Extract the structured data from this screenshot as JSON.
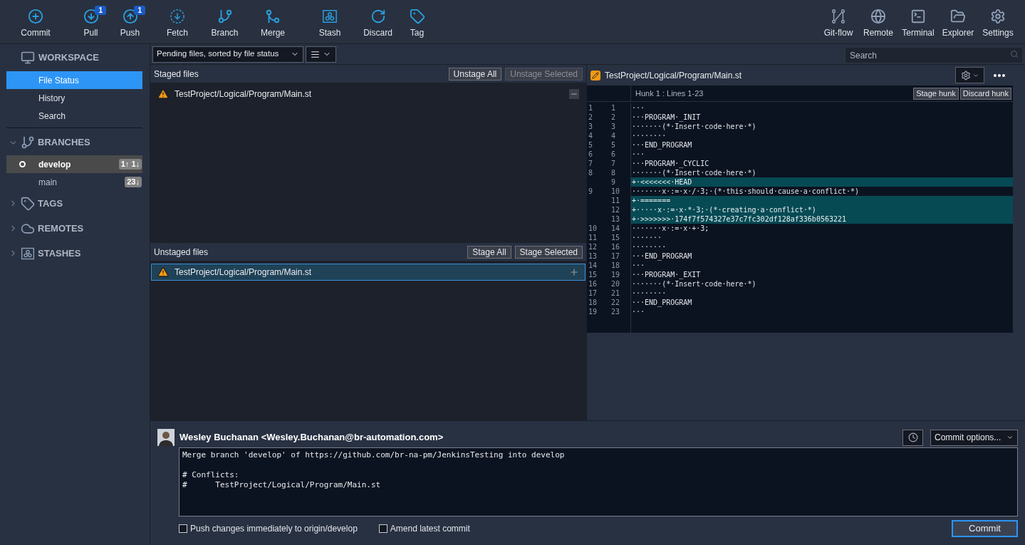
{
  "toolbar": {
    "left": [
      {
        "label": "Commit"
      },
      {
        "label": "Pull",
        "badge": "1"
      },
      {
        "label": "Push",
        "badge": "1"
      },
      {
        "label": "Fetch"
      },
      {
        "label": "Branch"
      },
      {
        "label": "Merge"
      },
      {
        "label": "Stash"
      },
      {
        "label": "Discard"
      },
      {
        "label": "Tag"
      }
    ],
    "right": [
      {
        "label": "Git-flow"
      },
      {
        "label": "Remote"
      },
      {
        "label": "Terminal"
      },
      {
        "label": "Explorer"
      },
      {
        "label": "Settings"
      }
    ]
  },
  "sidebar": {
    "workspace": {
      "title": "WORKSPACE",
      "items": [
        {
          "label": "File Status",
          "selected": true
        },
        {
          "label": "History",
          "selected": false
        },
        {
          "label": "Search",
          "selected": false
        }
      ]
    },
    "branches": {
      "title": "BRANCHES",
      "expanded": true,
      "items": [
        {
          "label": "develop",
          "current": true,
          "selected": true,
          "badge": "1↑ 1↓"
        },
        {
          "label": "main",
          "current": false,
          "selected": false,
          "badge": "23↓"
        }
      ]
    },
    "groups": [
      {
        "title": "TAGS",
        "expanded": false
      },
      {
        "title": "REMOTES",
        "expanded": false
      },
      {
        "title": "STASHES",
        "expanded": false
      }
    ]
  },
  "filter": {
    "value": "Pending files, sorted by file status"
  },
  "search": {
    "placeholder": "Search"
  },
  "staged": {
    "title": "Staged files",
    "buttons": [
      {
        "label": "Unstage All",
        "disabled": false
      },
      {
        "label": "Unstage Selected",
        "disabled": true
      }
    ],
    "files": [
      {
        "path": "TestProject/Logical/Program/Main.st",
        "selected": false
      }
    ]
  },
  "unstaged": {
    "title": "Unstaged files",
    "buttons": [
      {
        "label": "Stage All",
        "disabled": false
      },
      {
        "label": "Stage Selected",
        "disabled": false
      }
    ],
    "files": [
      {
        "path": "TestProject/Logical/Program/Main.st",
        "selected": true
      }
    ]
  },
  "diff": {
    "file": "TestProject/Logical/Program/Main.st",
    "hunk": "Hunk 1 : Lines 1-23",
    "buttons": [
      "Stage hunk",
      "Discard hunk"
    ],
    "lines": [
      {
        "old": "1",
        "new": "1",
        "kind": "context",
        "text": "···"
      },
      {
        "old": "2",
        "new": "2",
        "kind": "context",
        "text": "···PROGRAM·_INIT"
      },
      {
        "old": "3",
        "new": "3",
        "kind": "context",
        "text": "·······(*·Insert·code·here·*)"
      },
      {
        "old": "4",
        "new": "4",
        "kind": "context",
        "text": "········"
      },
      {
        "old": "5",
        "new": "5",
        "kind": "context",
        "text": "···END_PROGRAM"
      },
      {
        "old": "6",
        "new": "6",
        "kind": "context",
        "text": "···"
      },
      {
        "old": "7",
        "new": "7",
        "kind": "context",
        "text": "···PROGRAM·_CYCLIC"
      },
      {
        "old": "8",
        "new": "8",
        "kind": "context",
        "text": "·······(*·Insert·code·here·*)"
      },
      {
        "new": "9",
        "kind": "added",
        "text": "+·<<<<<<<·HEAD"
      },
      {
        "old": "9",
        "new": "10",
        "kind": "context",
        "text": "·······x·:=·x·/·3;·(*·this·should·cause·a·conflict·*)"
      },
      {
        "new": "11",
        "kind": "added",
        "text": "+·======="
      },
      {
        "new": "12",
        "kind": "added",
        "text": "+·····x·:=·x·*·3;·(*·creating·a·conflict·*)"
      },
      {
        "new": "13",
        "kind": "added",
        "text": "+·>>>>>>>·174f7f574327e37c7fc302df128af336b0563221"
      },
      {
        "old": "10",
        "new": "14",
        "kind": "context",
        "text": "·······x·:=·x·+·3;"
      },
      {
        "old": "11",
        "new": "15",
        "kind": "context",
        "text": "·······"
      },
      {
        "old": "12",
        "new": "16",
        "kind": "context",
        "text": "········"
      },
      {
        "old": "13",
        "new": "17",
        "kind": "context",
        "text": "···END_PROGRAM"
      },
      {
        "old": "14",
        "new": "18",
        "kind": "context",
        "text": "···"
      },
      {
        "old": "15",
        "new": "19",
        "kind": "context",
        "text": "···PROGRAM·_EXIT"
      },
      {
        "old": "16",
        "new": "20",
        "kind": "context",
        "text": "·······(*·Insert·code·here·*)"
      },
      {
        "old": "17",
        "new": "21",
        "kind": "context",
        "text": "········"
      },
      {
        "old": "18",
        "new": "22",
        "kind": "context",
        "text": "···END_PROGRAM"
      },
      {
        "old": "19",
        "new": "23",
        "kind": "context",
        "text": "···"
      }
    ]
  },
  "commit": {
    "author": "Wesley Buchanan <Wesley.Buchanan@br-automation.com>",
    "options": "Commit options...",
    "message": "Merge branch 'develop' of https://github.com/br-na-pm/JenkinsTesting into develop\n\n# Conflicts:\n#      TestProject/Logical/Program/Main.st",
    "checkboxes": [
      {
        "label": "Push changes immediately to origin/develop",
        "checked": false
      },
      {
        "label": "Amend latest commit",
        "checked": false
      }
    ],
    "button": "Commit"
  }
}
